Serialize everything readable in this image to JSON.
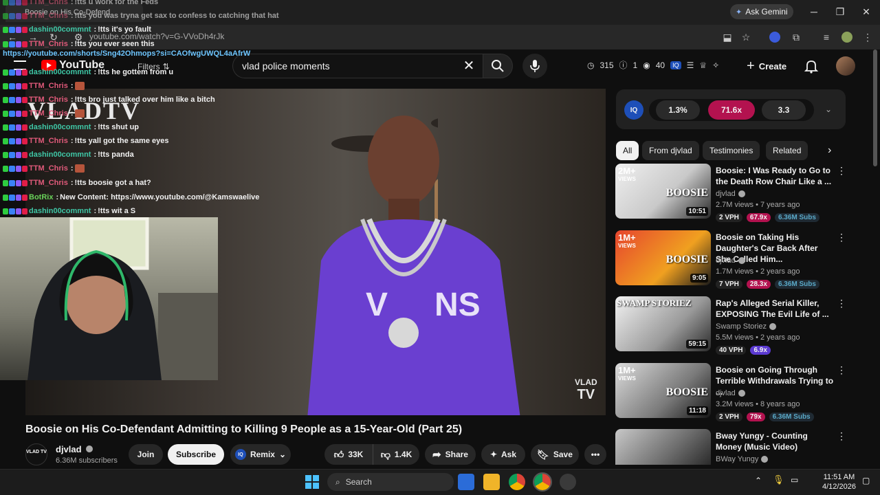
{
  "browser": {
    "tab_title": "Boosie on His Co-Defend",
    "ask_gemini": "Ask Gemini",
    "url": "youtube.com/watch?v=G-VVoDh4rJk"
  },
  "chat": {
    "link": "https://youtube.com/shorts/Sng42Ohmops?si=CAOfwgUWQL4aAfrW",
    "lines": [
      {
        "user": "TTM_Chris",
        "msg": "!tts u work for the Feds",
        "color": "#e05a7a"
      },
      {
        "user": "TTM_Chris",
        "msg": "!tts you was tryna get sax to confess to catching that hat",
        "color": "#e05a7a"
      },
      {
        "user": "dashin00commnt",
        "msg": "!tts it's yo fault",
        "color": "#3fc7a6"
      },
      {
        "user": "TTM_Chris",
        "msg": "!tts you ever seen this",
        "color": "#e05a7a"
      },
      {
        "user": "dashin00commnt",
        "msg": "!tts he gottem from u",
        "color": "#3fc7a6"
      },
      {
        "user": "TTM_Chris",
        "msg": "",
        "color": "#e05a7a"
      },
      {
        "user": "TTM_Chris",
        "msg": "!tts bro just talked over him like a bitch",
        "color": "#e05a7a"
      },
      {
        "user": "TTM_Chris",
        "msg": "",
        "color": "#e05a7a"
      },
      {
        "user": "dashin00commnt",
        "msg": "!tts shut up",
        "color": "#3fc7a6"
      },
      {
        "user": "TTM_Chris",
        "msg": "!tts yall got the same eyes",
        "color": "#e05a7a"
      },
      {
        "user": "dashin00commnt",
        "msg": "!tts panda",
        "color": "#3fc7a6"
      },
      {
        "user": "TTM_Chris",
        "msg": "",
        "color": "#e05a7a"
      },
      {
        "user": "TTM_Chris",
        "msg": "!tts boosie got a hat?",
        "color": "#e05a7a"
      },
      {
        "user": "BotRix",
        "msg": "New Content: https://www.youtube.com/@Kamswaelive",
        "color": "#6ad35a"
      },
      {
        "user": "dashin00commnt",
        "msg": "!tts wit a S",
        "color": "#3fc7a6"
      }
    ]
  },
  "header": {
    "logo": "YouTube",
    "filters": "Filters",
    "search_value": "vlad police moments",
    "stats": {
      "a": "315",
      "b": "1",
      "c": "40"
    },
    "create": "Create"
  },
  "video": {
    "watermark_top": "VLADTV",
    "watermark_br_1": "VLAD",
    "watermark_br_2": "TV",
    "title": "Boosie on His Co-Defendant Admitting to Killing 9 People as a 15-Year-Old (Part 25)",
    "channel": "djvlad",
    "subs": "6.36M subscribers",
    "avatar_text": "VLAD TV"
  },
  "actions": {
    "join": "Join",
    "subscribe": "Subscribe",
    "remix": "Remix",
    "likes": "33K",
    "dislikes": "1.4K",
    "share": "Share",
    "ask": "Ask",
    "save": "Save"
  },
  "iq": {
    "label": "IQ",
    "v1": "1.3%",
    "v2": "71.6x",
    "v3": "3.3"
  },
  "chips": [
    "All",
    "From djvlad",
    "Testimonies",
    "Related"
  ],
  "recs": [
    {
      "title": "Boosie: I Was Ready to Go to the Death Row Chair Like a ...",
      "channel": "djvlad",
      "meta": "2.7M views • 7 years ago",
      "duration": "10:51",
      "badge_top": "2M+",
      "badge_bot": "VIEWS",
      "thumb_text": "BOOSIE",
      "vph": "2 VPH",
      "mult": "67.9x",
      "mult_color": "#b3124f",
      "subs": "6.36M Subs"
    },
    {
      "title": "Boosie on Taking His Daughter's Car Back After She Called Him...",
      "channel": "djvlad",
      "meta": "1.7M views • 2 years ago",
      "duration": "9:05",
      "badge_top": "1M+",
      "badge_bot": "VIEWS",
      "thumb_text": "BOOSIE",
      "vph": "7 VPH",
      "mult": "28.3x",
      "mult_color": "#b3124f",
      "subs": "6.36M Subs"
    },
    {
      "title": "Rap's Alleged Serial Killer, EXPOSING The Evil Life of ...",
      "channel": "Swamp Storiez",
      "meta": "5.5M views • 2 years ago",
      "duration": "59:15",
      "badge_top": "",
      "badge_bot": "",
      "thumb_text": "SWAMP STORIEZ",
      "vph": "40 VPH",
      "mult": "6.9x",
      "mult_color": "#5b3ad1",
      "subs": ""
    },
    {
      "title": "Boosie on Going Through Terrible Withdrawals Trying to ...",
      "channel": "djvlad",
      "meta": "3.2M views • 8 years ago",
      "duration": "11:18",
      "badge_top": "1M+",
      "badge_bot": "VIEWS",
      "thumb_text": "BOOSIE",
      "vph": "2 VPH",
      "mult": "79x",
      "mult_color": "#b3124f",
      "subs": "6.36M Subs"
    },
    {
      "title": "Bway Yungy - Counting Money (Music Video)",
      "channel": "BWay Yungy",
      "meta": "",
      "duration": "",
      "badge_top": "",
      "badge_bot": "",
      "thumb_text": "",
      "vph": "",
      "mult": "",
      "mult_color": "",
      "subs": ""
    }
  ],
  "taskbar": {
    "search": "Search",
    "time": "11:51 AM",
    "date": "4/12/2026"
  }
}
